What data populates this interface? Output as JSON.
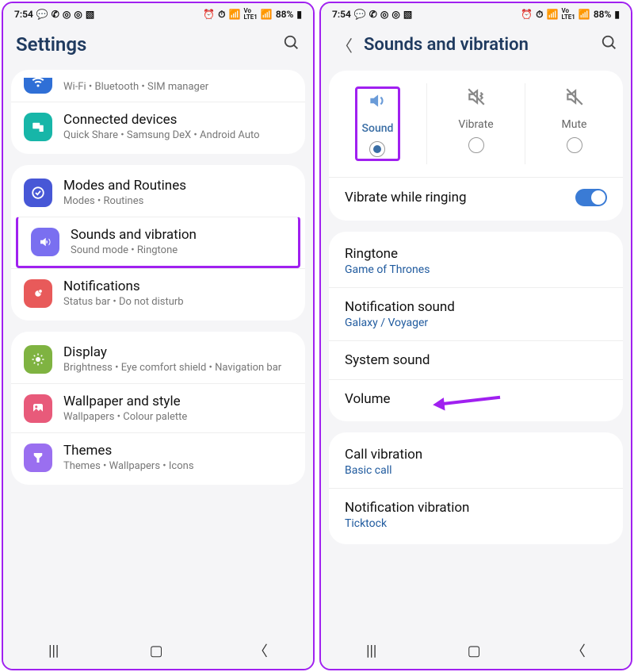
{
  "status": {
    "time": "7:54",
    "battery": "88%",
    "net": "LTE1",
    "vo": "Vo"
  },
  "left": {
    "title": "Settings",
    "groups": [
      {
        "items": [
          {
            "key": "connections",
            "icon": "wifi",
            "color": "#2f6fd6",
            "title": "",
            "sub": "Wi-Fi  •  Bluetooth  •  SIM manager",
            "partial": true
          },
          {
            "key": "connected",
            "icon": "devices",
            "color": "#17b6a8",
            "title": "Connected devices",
            "sub": "Quick Share  •  Samsung DeX  •  Android Auto"
          }
        ]
      },
      {
        "items": [
          {
            "key": "modes",
            "icon": "check",
            "color": "#4757d6",
            "title": "Modes and Routines",
            "sub": "Modes  •  Routines"
          },
          {
            "key": "sounds",
            "icon": "sound",
            "color": "#7a6ff0",
            "title": "Sounds and vibration",
            "sub": "Sound mode  •  Ringtone",
            "highlight": true
          },
          {
            "key": "notifications",
            "icon": "notif",
            "color": "#e85a5a",
            "title": "Notifications",
            "sub": "Status bar  •  Do not disturb"
          }
        ]
      },
      {
        "items": [
          {
            "key": "display",
            "icon": "sun",
            "color": "#7fb341",
            "title": "Display",
            "sub": "Brightness  •  Eye comfort shield  •  Navigation bar"
          },
          {
            "key": "wallpaper",
            "icon": "image",
            "color": "#e85a7a",
            "title": "Wallpaper and style",
            "sub": "Wallpapers  •  Colour palette"
          },
          {
            "key": "themes",
            "icon": "theme",
            "color": "#9a6ff0",
            "title": "Themes",
            "sub": "Themes  •  Wallpapers  •  Icons"
          }
        ]
      }
    ]
  },
  "right": {
    "title": "Sounds and vibration",
    "modes": [
      {
        "key": "sound",
        "label": "Sound",
        "active": true
      },
      {
        "key": "vibrate",
        "label": "Vibrate",
        "active": false
      },
      {
        "key": "mute",
        "label": "Mute",
        "active": false
      }
    ],
    "group1": [
      {
        "title": "Vibrate while ringing",
        "toggle": true
      }
    ],
    "group2": [
      {
        "title": "Ringtone",
        "sub": "Game of Thrones"
      },
      {
        "title": "Notification sound",
        "sub": "Galaxy / Voyager"
      },
      {
        "title": "System sound"
      },
      {
        "title": "Volume",
        "arrow": true
      }
    ],
    "group3": [
      {
        "title": "Call vibration",
        "sub": "Basic call"
      },
      {
        "title": "Notification vibration",
        "sub": "Ticktock"
      }
    ]
  }
}
